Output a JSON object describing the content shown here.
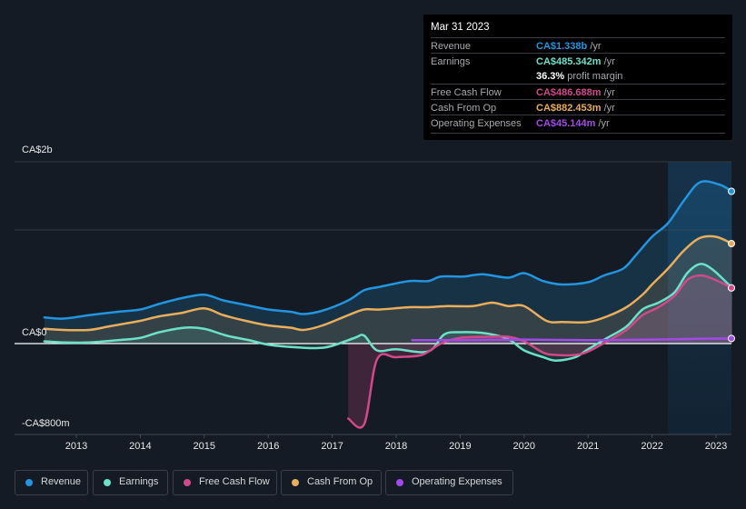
{
  "tooltip": {
    "date": "Mar 31 2023",
    "rows": [
      {
        "label": "Revenue",
        "value": "CA$1.338b",
        "unit": "/yr",
        "color": "#2394df"
      },
      {
        "label": "Earnings",
        "value": "CA$485.342m",
        "unit": "/yr",
        "color": "#6ce0c8"
      },
      {
        "label": "",
        "value": "36.3%",
        "unit": "profit margin",
        "color": "#ffffff"
      },
      {
        "label": "Free Cash Flow",
        "value": "CA$486.688m",
        "unit": "/yr",
        "color": "#d1498a"
      },
      {
        "label": "Cash From Op",
        "value": "CA$882.453m",
        "unit": "/yr",
        "color": "#e9ad5c"
      },
      {
        "label": "Operating Expenses",
        "value": "CA$45.144m",
        "unit": "/yr",
        "color": "#a24ae8"
      }
    ]
  },
  "legend": [
    {
      "label": "Revenue",
      "color": "#2394df"
    },
    {
      "label": "Earnings",
      "color": "#6ce0c8"
    },
    {
      "label": "Free Cash Flow",
      "color": "#d1498a"
    },
    {
      "label": "Cash From Op",
      "color": "#e9ad5c"
    },
    {
      "label": "Operating Expenses",
      "color": "#a24ae8"
    }
  ],
  "chart_data": {
    "type": "area",
    "title": "",
    "xlabel": "",
    "ylabel": "",
    "units": "CA$ billions",
    "y_tick_labels": [
      "CA$2b",
      "CA$0",
      "-CA$800m"
    ],
    "x_tick_labels": [
      "2013",
      "2014",
      "2015",
      "2016",
      "2017",
      "2018",
      "2019",
      "2020",
      "2021",
      "2022",
      "2023"
    ],
    "x_ticks": [
      2013,
      2014,
      2015,
      2016,
      2017,
      2018,
      2019,
      2020,
      2021,
      2022,
      2023
    ],
    "xlim": [
      2012.5,
      2023.25
    ],
    "ylim": [
      -0.8,
      1.6
    ],
    "grid": true,
    "highlight_range": [
      2022.25,
      2023.25
    ],
    "series": [
      {
        "name": "Revenue",
        "color": "#2394df",
        "x": [
          2012.5,
          2012.8,
          2013.2,
          2013.65,
          2014.0,
          2014.3,
          2014.65,
          2015.0,
          2015.3,
          2015.65,
          2016.0,
          2016.35,
          2016.55,
          2016.85,
          2017.25,
          2017.5,
          2017.75,
          2018.2,
          2018.5,
          2018.7,
          2019.05,
          2019.35,
          2019.75,
          2020.0,
          2020.3,
          2020.6,
          2021.0,
          2021.25,
          2021.55,
          2021.75,
          2022.0,
          2022.25,
          2022.5,
          2022.75,
          2023.05,
          2023.25
        ],
        "y": [
          0.23,
          0.22,
          0.25,
          0.28,
          0.3,
          0.35,
          0.4,
          0.43,
          0.38,
          0.34,
          0.3,
          0.28,
          0.26,
          0.29,
          0.38,
          0.47,
          0.5,
          0.55,
          0.55,
          0.59,
          0.59,
          0.61,
          0.58,
          0.62,
          0.55,
          0.52,
          0.54,
          0.6,
          0.66,
          0.78,
          0.94,
          1.06,
          1.26,
          1.42,
          1.4,
          1.34
        ]
      },
      {
        "name": "Earnings",
        "color": "#6ce0c8",
        "x": [
          2012.5,
          2012.8,
          2013.2,
          2013.65,
          2014.0,
          2014.3,
          2014.7,
          2015.0,
          2015.35,
          2015.7,
          2016.0,
          2016.35,
          2016.75,
          2017.0,
          2017.35,
          2017.5,
          2017.7,
          2018.0,
          2018.5,
          2018.75,
          2019.0,
          2019.4,
          2019.75,
          2020.0,
          2020.3,
          2020.5,
          2020.8,
          2021.0,
          2021.3,
          2021.6,
          2021.85,
          2022.1,
          2022.35,
          2022.55,
          2022.75,
          2022.95,
          2023.25
        ],
        "y": [
          0.02,
          0.01,
          0.01,
          0.03,
          0.05,
          0.1,
          0.14,
          0.13,
          0.07,
          0.03,
          -0.01,
          -0.03,
          -0.04,
          -0.02,
          0.05,
          0.07,
          -0.06,
          -0.05,
          -0.07,
          0.08,
          0.1,
          0.09,
          0.04,
          -0.06,
          -0.12,
          -0.15,
          -0.12,
          -0.05,
          0.05,
          0.15,
          0.3,
          0.36,
          0.45,
          0.62,
          0.7,
          0.65,
          0.49
        ]
      },
      {
        "name": "Free Cash Flow",
        "color": "#d1498a",
        "x": [
          2017.25,
          2017.5,
          2017.7,
          2018.0,
          2018.4,
          2018.7,
          2019.0,
          2019.4,
          2019.75,
          2020.0,
          2020.3,
          2020.5,
          2020.8,
          2021.0,
          2021.3,
          2021.6,
          2021.85,
          2022.1,
          2022.35,
          2022.55,
          2022.75,
          2022.95,
          2023.25
        ],
        "y": [
          -0.66,
          -0.71,
          -0.14,
          -0.12,
          -0.1,
          0.0,
          0.05,
          0.06,
          0.06,
          0.02,
          -0.08,
          -0.1,
          -0.1,
          -0.07,
          0.02,
          0.12,
          0.25,
          0.32,
          0.42,
          0.56,
          0.6,
          0.57,
          0.49
        ]
      },
      {
        "name": "Cash From Op",
        "color": "#e9ad5c",
        "x": [
          2012.5,
          2012.8,
          2013.2,
          2013.5,
          2013.8,
          2014.0,
          2014.3,
          2014.65,
          2015.0,
          2015.3,
          2015.65,
          2016.0,
          2016.35,
          2016.55,
          2016.85,
          2017.25,
          2017.5,
          2017.75,
          2018.2,
          2018.5,
          2018.8,
          2019.2,
          2019.5,
          2019.75,
          2020.0,
          2020.35,
          2020.6,
          2021.0,
          2021.3,
          2021.6,
          2021.85,
          2022.0,
          2022.25,
          2022.5,
          2022.75,
          2023.0,
          2023.25
        ],
        "y": [
          0.13,
          0.12,
          0.12,
          0.15,
          0.18,
          0.2,
          0.24,
          0.27,
          0.31,
          0.25,
          0.2,
          0.16,
          0.14,
          0.12,
          0.16,
          0.25,
          0.3,
          0.3,
          0.32,
          0.32,
          0.33,
          0.33,
          0.36,
          0.33,
          0.33,
          0.2,
          0.19,
          0.19,
          0.24,
          0.32,
          0.43,
          0.52,
          0.66,
          0.82,
          0.93,
          0.94,
          0.88
        ]
      },
      {
        "name": "Operating Expenses",
        "color": "#a24ae8",
        "x": [
          2018.25,
          2019.0,
          2020.0,
          2021.0,
          2022.0,
          2022.5,
          2023.0,
          2023.25
        ],
        "y": [
          0.03,
          0.03,
          0.035,
          0.03,
          0.035,
          0.04,
          0.044,
          0.045
        ]
      }
    ]
  }
}
